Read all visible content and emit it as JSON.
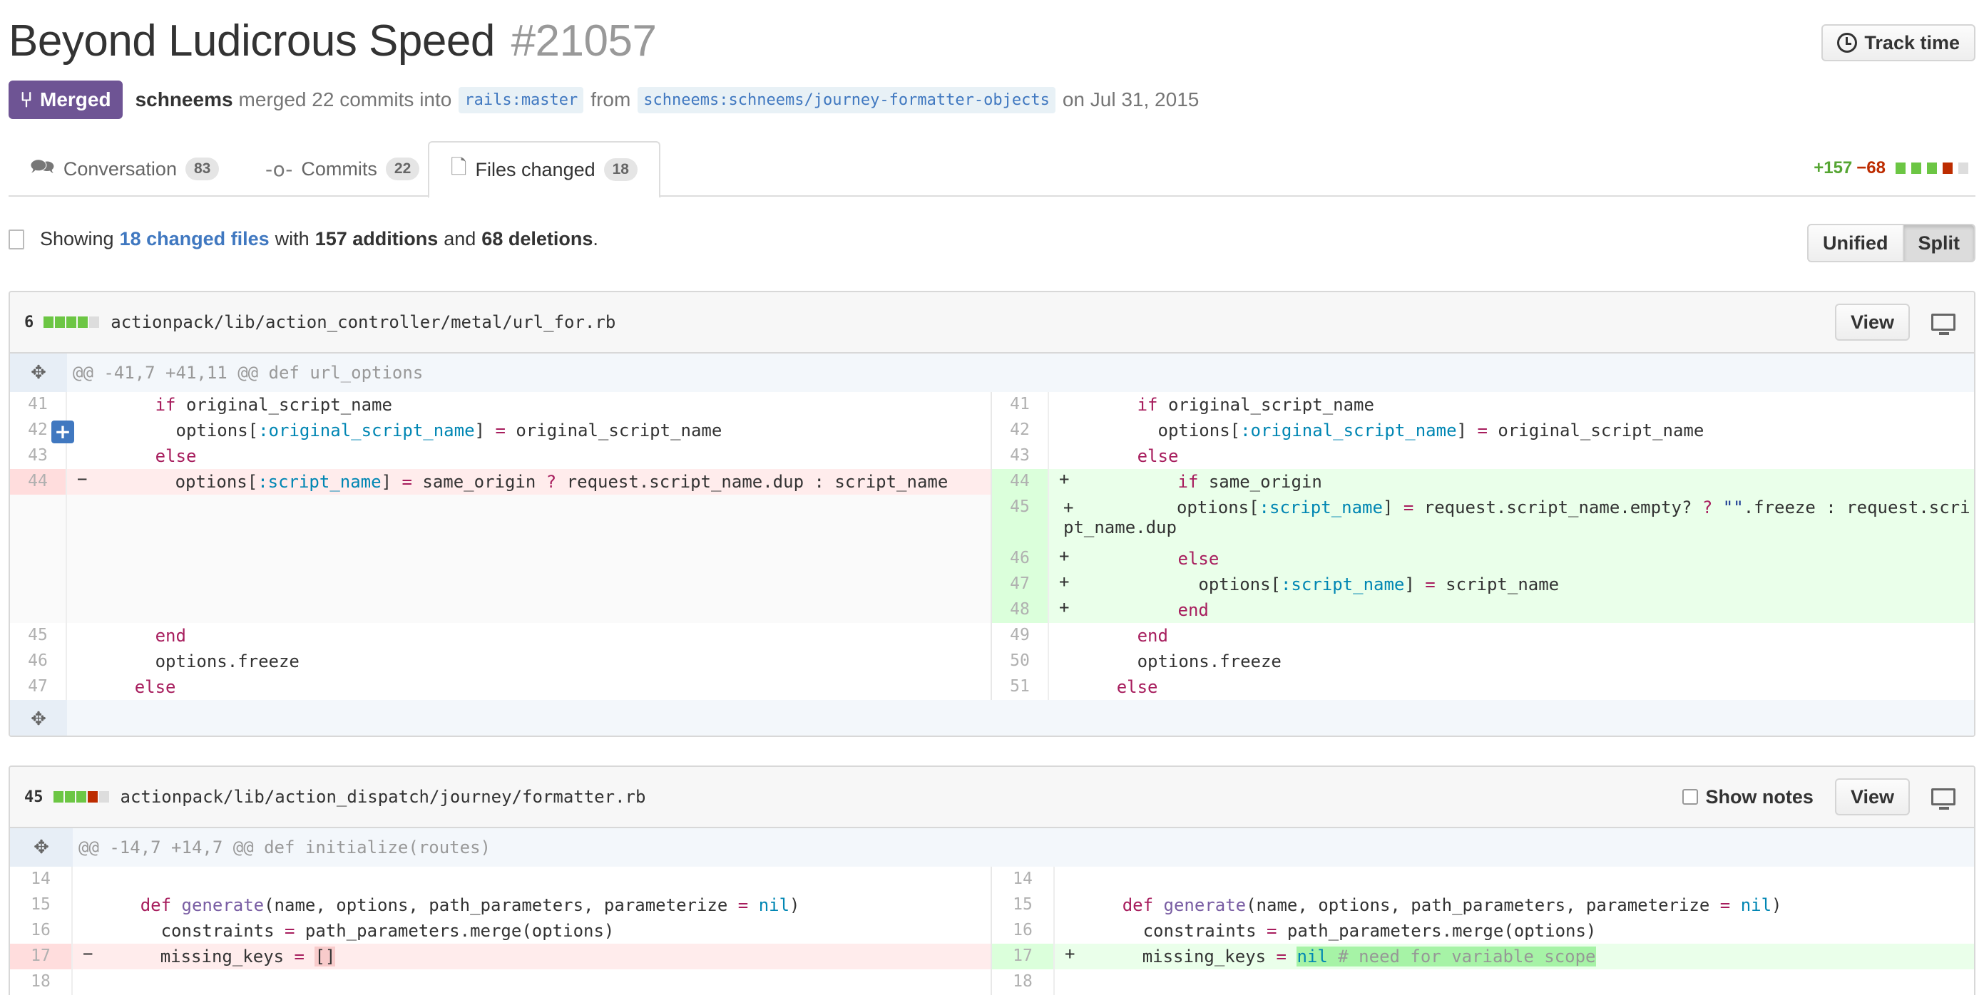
{
  "pr": {
    "title": "Beyond Ludicrous Speed",
    "number": "#21057",
    "state": "Merged",
    "author": "schneems",
    "action": "merged 22 commits into",
    "base_ref": "rails:master",
    "from": "from",
    "head_ref": "schneems:schneems/journey-formatter-objects",
    "date": "on Jul 31, 2015",
    "track_time": "Track time"
  },
  "tabs": [
    {
      "label": "Conversation",
      "count": "83",
      "icon": "comment-discussion-icon"
    },
    {
      "label": "Commits",
      "count": "22",
      "icon": "git-commit-icon"
    },
    {
      "label": "Files changed",
      "count": "18",
      "icon": "diff-icon"
    }
  ],
  "diffstat": {
    "additions": "+157",
    "deletions": "−68"
  },
  "summary": {
    "showing": "Showing",
    "changed_files": "18 changed files",
    "with": "with",
    "additions": "157 additions",
    "and": "and",
    "deletions": "68 deletions",
    "end": "."
  },
  "view_toggle": {
    "unified": "Unified",
    "split": "Split"
  },
  "files": [
    {
      "count": "6",
      "path": "actionpack/lib/action_controller/metal/url_for.rb",
      "view": "View",
      "hunk": "@@ -41,7 +41,11 @@ def url_options"
    },
    {
      "count": "45",
      "path": "actionpack/lib/action_dispatch/journey/formatter.rb",
      "view": "View",
      "show_notes": "Show notes",
      "hunk": "@@ -14,7 +14,7 @@ def initialize(routes)"
    }
  ],
  "colors": {
    "merged": "#6e5494",
    "link": "#4078c0",
    "addition": "#55a532",
    "deletion": "#bd2c00"
  }
}
